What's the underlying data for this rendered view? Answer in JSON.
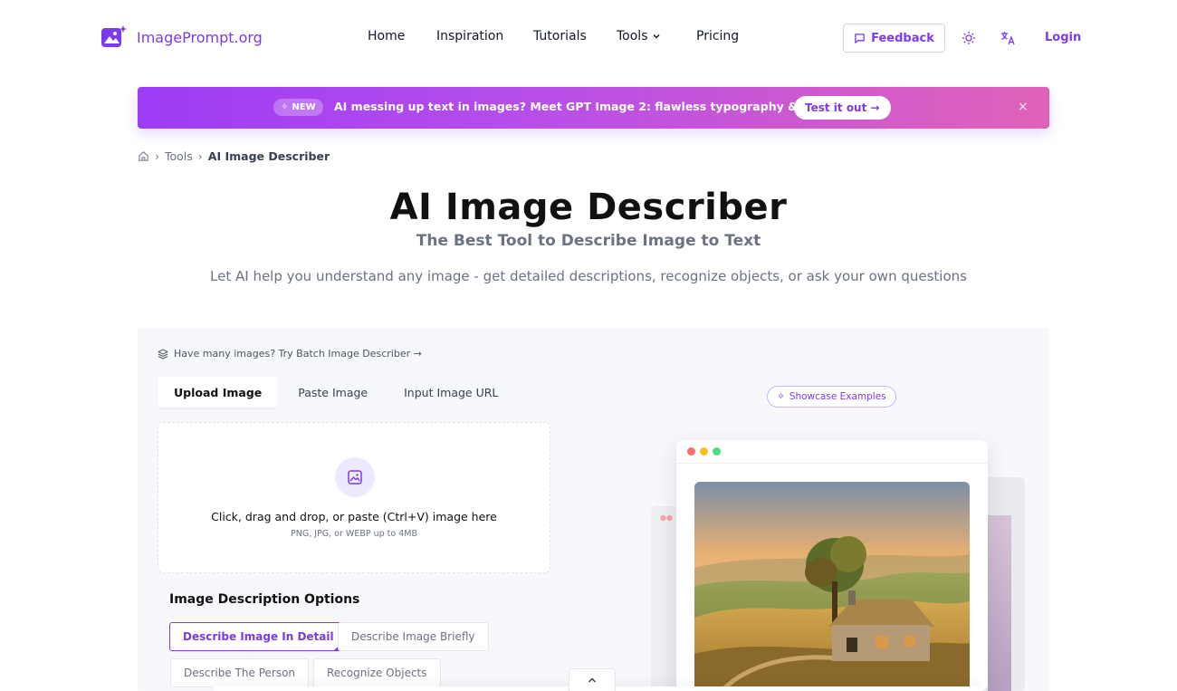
{
  "header": {
    "logo_text": "ImagePrompt.org",
    "nav": {
      "home": "Home",
      "inspiration": "Inspiration",
      "tutorials": "Tutorials",
      "tools": "Tools",
      "pricing": "Pricing"
    },
    "feedback_label": "Feedback",
    "login_label": "Login",
    "accent_color": "#7c3aed"
  },
  "banner": {
    "badge": "NEW",
    "text": "AI messing up text in images? Meet GPT Image 2: flawless typography & design.",
    "cta": "Test it out →",
    "close": "×"
  },
  "breadcrumb": {
    "tools": "Tools",
    "current": "AI Image Describer"
  },
  "hero": {
    "title": "AI Image Describer",
    "subtitle": "The Best Tool to Describe Image to Text",
    "description": "Let AI help you understand any image - get detailed descriptions, recognize objects, or ask your own questions"
  },
  "tool": {
    "batch_link": "Have many images? Try Batch Image Describer →",
    "tabs": [
      {
        "label": "Upload Image",
        "active": true
      },
      {
        "label": "Paste Image",
        "active": false
      },
      {
        "label": "Input Image URL",
        "active": false
      }
    ],
    "dropzone": {
      "title": "Click, drag and drop, or paste (Ctrl+V) image here",
      "subtitle": "PNG, JPG, or WEBP up to 4MB"
    },
    "options_title": "Image Description Options",
    "options": [
      {
        "label": "Describe Image In Detail",
        "selected": true
      },
      {
        "label": "Describe Image Briefly",
        "selected": false
      },
      {
        "label": "Describe The Person",
        "selected": false
      },
      {
        "label": "Recognize Objects",
        "selected": false
      }
    ]
  },
  "showcase": {
    "chip": "Showcase Examples"
  }
}
